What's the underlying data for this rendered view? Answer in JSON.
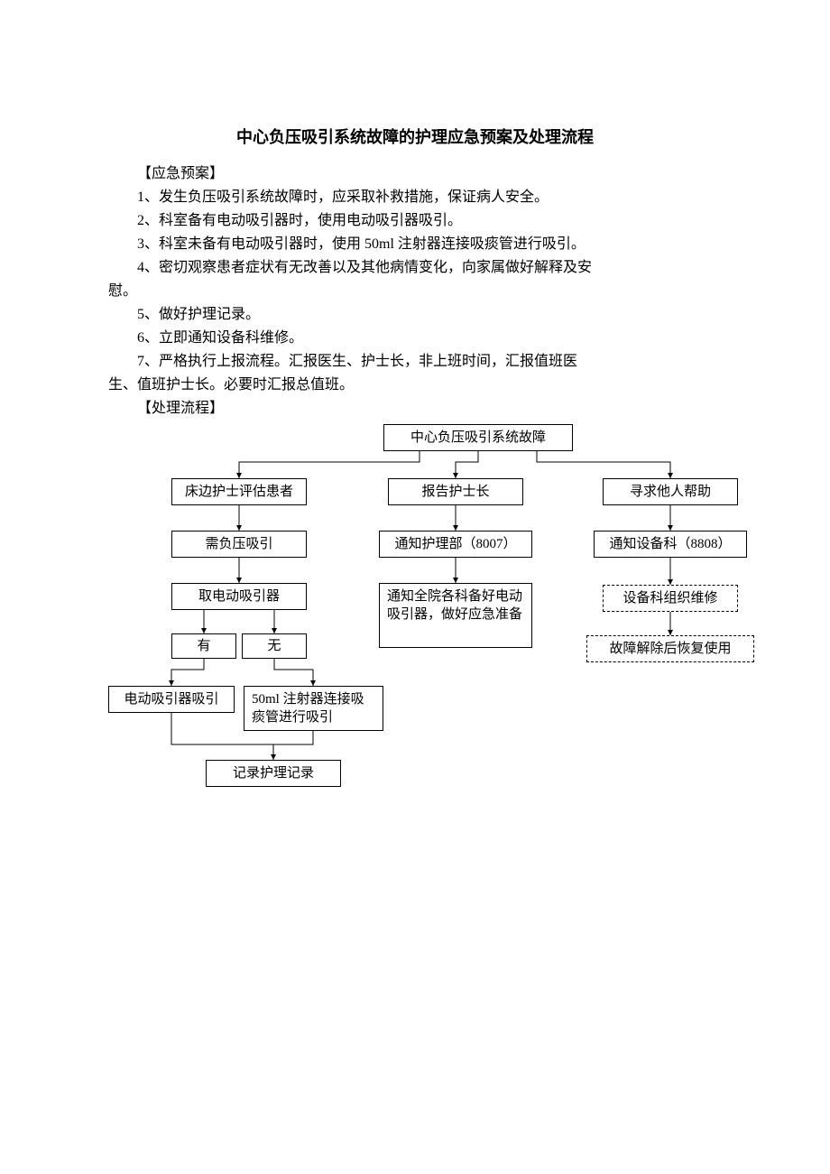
{
  "title": "中心负压吸引系统故障的护理应急预案及处理流程",
  "section_plan_label": "【应急预案】",
  "plan_items": {
    "p1": "1、发生负压吸引系统故障时，应采取补救措施，保证病人安全。",
    "p2": "2、科室备有电动吸引器时，使用电动吸引器吸引。",
    "p3": "3、科室未备有电动吸引器时，使用 50ml 注射器连接吸痰管进行吸引。",
    "p4a": "4、密切观察患者症状有无改善以及其他病情变化，向家属做好解释及安",
    "p4b": "慰。",
    "p5": "5、做好护理记录。",
    "p6": "6、立即通知设备科维修。",
    "p7a": "7、严格执行上报流程。汇报医生、护士长，非上班时间，汇报值班医",
    "p7b": "生、值班护士长。必要时汇报总值班。"
  },
  "section_flow_label": "【处理流程】",
  "flow": {
    "top": "中心负压吸引系统故障",
    "a1": "床边护士评估患者",
    "a2": "需负压吸引",
    "a3": "取电动吸引器",
    "a3_yes": "有",
    "a3_no": "无",
    "a4_left": "电动吸引器吸引",
    "a4_right": "50ml 注射器连接吸痰管进行吸引",
    "a5": "记录护理记录",
    "b1": "报告护士长",
    "b2": "通知护理部（8007）",
    "b3": "通知全院各科备好电动吸引器，做好应急准备",
    "c1": "寻求他人帮助",
    "c2": "通知设备科（8808）",
    "c3": "设备科组织维修",
    "c4": "故障解除后恢复使用"
  }
}
